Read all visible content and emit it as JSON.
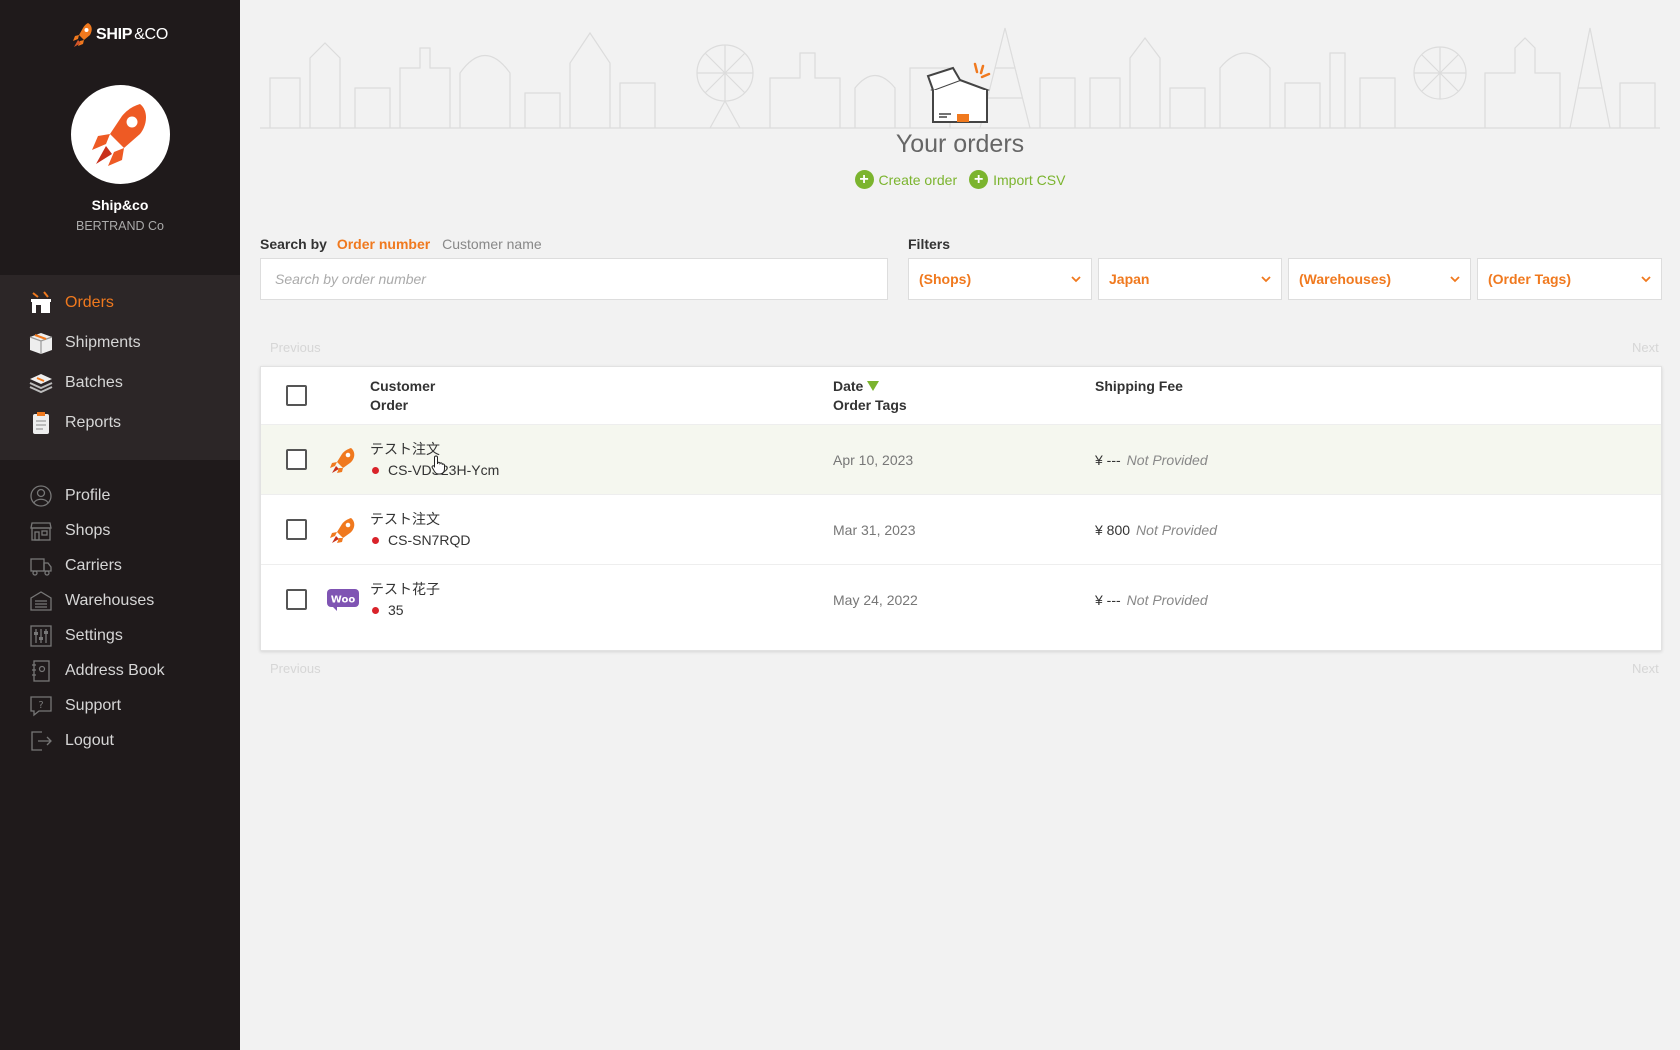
{
  "brand": {
    "logo_text": "SHIP",
    "logo_amp": "&CO"
  },
  "account": {
    "name": "Ship&co",
    "company": "BERTRAND Co"
  },
  "nav": {
    "main": [
      {
        "label": "Orders",
        "icon": "store-icon",
        "active": true
      },
      {
        "label": "Shipments",
        "icon": "box-icon"
      },
      {
        "label": "Batches",
        "icon": "stack-icon"
      },
      {
        "label": "Reports",
        "icon": "clipboard-icon"
      }
    ],
    "secondary": [
      {
        "label": "Profile",
        "icon": "user-icon"
      },
      {
        "label": "Shops",
        "icon": "shop-icon"
      },
      {
        "label": "Carriers",
        "icon": "truck-icon"
      },
      {
        "label": "Warehouses",
        "icon": "warehouse-icon"
      },
      {
        "label": "Settings",
        "icon": "sliders-icon"
      },
      {
        "label": "Address Book",
        "icon": "book-icon"
      },
      {
        "label": "Support",
        "icon": "help-icon"
      },
      {
        "label": "Logout",
        "icon": "logout-icon"
      }
    ]
  },
  "header": {
    "title": "Your orders",
    "create_order": "Create order",
    "import_csv": "Import CSV"
  },
  "search": {
    "label": "Search by",
    "option_active": "Order number",
    "option_other": "Customer name",
    "placeholder": "Search by order number",
    "value": ""
  },
  "filters": {
    "label": "Filters",
    "shops": "(Shops)",
    "country": "Japan",
    "warehouses": "(Warehouses)",
    "order_tags": "(Order Tags)"
  },
  "pager": {
    "previous": "Previous",
    "next": "Next"
  },
  "table": {
    "col_customer": "Customer",
    "col_order": "Order",
    "col_date": "Date",
    "col_order_tags": "Order Tags",
    "col_shipping_fee": "Shipping Fee",
    "rows": [
      {
        "customer": "テスト注文",
        "order": "CS-VDS23H-Ycm",
        "date": "Apr 10, 2023",
        "fee": "¥ ---",
        "fee_note": "Not Provided",
        "source": "shipandco-rocket-icon"
      },
      {
        "customer": "テスト注文",
        "order": "CS-SN7RQD",
        "date": "Mar 31, 2023",
        "fee": "¥ 800",
        "fee_note": "Not Provided",
        "source": "shipandco-rocket-icon"
      },
      {
        "customer": "テスト花子",
        "order": "35",
        "date": "May 24, 2022",
        "fee": "¥ ---",
        "fee_note": "Not Provided",
        "source": "woocommerce-icon"
      }
    ]
  },
  "colors": {
    "accent": "#f0791e",
    "green": "#7bb42e",
    "sidebar": "#1f1a1b"
  }
}
